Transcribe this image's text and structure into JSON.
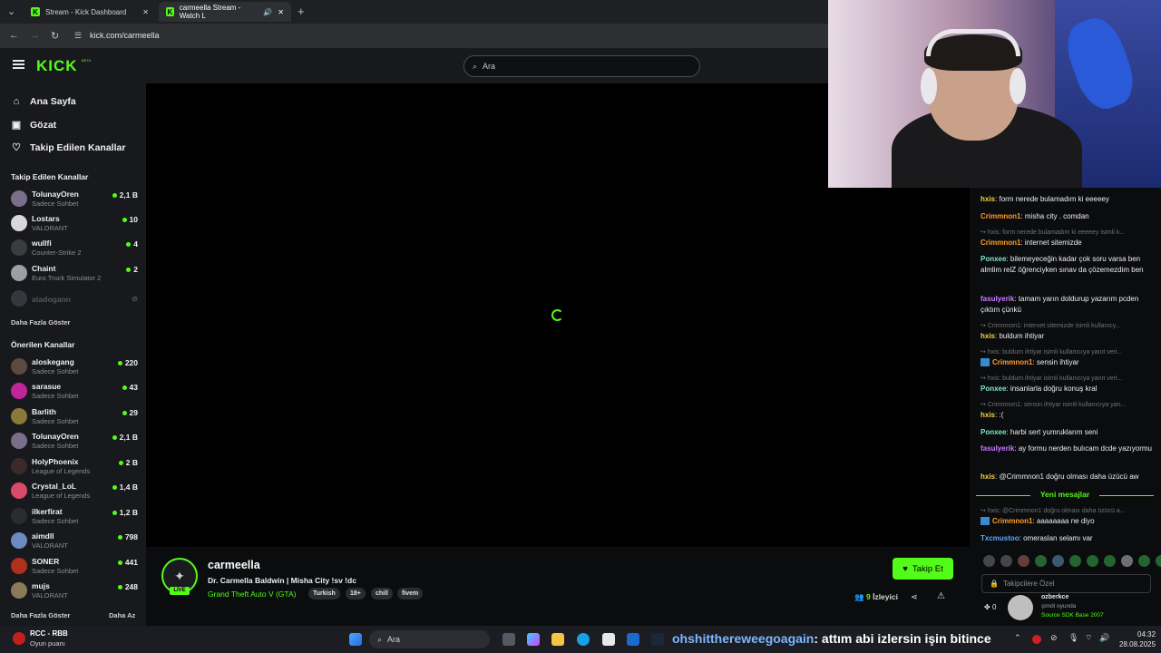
{
  "browser": {
    "tabs": [
      {
        "title": "Stream - Kick Dashboard",
        "active": false
      },
      {
        "title": "carmeella Stream - Watch L",
        "active": true
      }
    ],
    "url": "kick.com/carmeella"
  },
  "header": {
    "logo": "KICK",
    "beta": "BETA",
    "search_placeholder": "Ara"
  },
  "sidebar": {
    "nav": [
      {
        "label": "Ana Sayfa",
        "icon": "home-icon"
      },
      {
        "label": "Gözat",
        "icon": "browse-icon"
      },
      {
        "label": "Takip Edilen Kanallar",
        "icon": "heart-icon"
      }
    ],
    "followed_title": "Takip Edilen Kanallar",
    "followed": [
      {
        "name": "TolunayOren",
        "game": "Sadece Sohbet",
        "viewers": "2,1 B"
      },
      {
        "name": "Lostars",
        "game": "VALORANT",
        "viewers": "10"
      },
      {
        "name": "wullfi",
        "game": "Counter-Strike 2",
        "viewers": "4"
      },
      {
        "name": "Chaint",
        "game": "Euro Truck Simulator 2",
        "viewers": "2"
      },
      {
        "name": "atadogann",
        "game": "",
        "viewers": ""
      }
    ],
    "show_more_1": "Daha Fazla Göster",
    "recommended_title": "Önerilen Kanallar",
    "recommended": [
      {
        "name": "aloskegang",
        "game": "Sadece Sohbet",
        "viewers": "220"
      },
      {
        "name": "sarasue",
        "game": "Sadece Sohbet",
        "viewers": "43"
      },
      {
        "name": "Barlith",
        "game": "Sadece Sohbet",
        "viewers": "29"
      },
      {
        "name": "TolunayOren",
        "game": "Sadece Sohbet",
        "viewers": "2,1 B"
      },
      {
        "name": "HolyPhoenix",
        "game": "League of Legends",
        "viewers": "2 B"
      },
      {
        "name": "Crystal_LoL",
        "game": "League of Legends",
        "viewers": "1,4 B"
      },
      {
        "name": "ilkerfirat",
        "game": "Sadece Sohbet",
        "viewers": "1,2 B"
      },
      {
        "name": "aimdll",
        "game": "VALORANT",
        "viewers": "798"
      },
      {
        "name": "SONER",
        "game": "Sadece Sohbet",
        "viewers": "441"
      },
      {
        "name": "mujs",
        "game": "VALORANT",
        "viewers": "248"
      }
    ],
    "show_more_2": "Daha Fazla Göster",
    "show_less": "Daha Az"
  },
  "stream": {
    "live": "LIVE",
    "streamer": "carmeella",
    "title": "Dr. Carmella Baldwin |  Misha City   !sv !dc",
    "category": "Grand Theft Auto V (GTA)",
    "tags": [
      "Turkish",
      "18+",
      "chill",
      "fivem"
    ],
    "follow_label": "Takip Et",
    "viewer_count": "9",
    "viewer_label": "İzleyici"
  },
  "chat": {
    "messages": [
      {
        "reply": "",
        "user": "hxis",
        "color": "#f5d442",
        "text": "form nerede bulamadım ki eeeeey"
      },
      {
        "reply": "",
        "user": "Crimmnon1",
        "color": "#ff9e2c",
        "text": "misha city . comdan"
      },
      {
        "reply": "hxis: form nerede bulamadım ki eeeeey isimli k...",
        "user": "Crimmnon1",
        "color": "#ff9e2c",
        "text": "internet sitemizde"
      },
      {
        "reply": "",
        "user": "Ponxee",
        "color": "#7ee8c8",
        "text": "bilemeyeceğin kadar çok soru varsa ben almlim relZ öğrenciyken sınav da çözemezdim ben"
      },
      {
        "reply": "",
        "user": "fasulyerik",
        "color": "#c77dff",
        "text": "tamam yarın doldurup yazarım pcden çıktım çünkü"
      },
      {
        "reply": "Crimmnon1: internet sitemizde isimli kullanıcy...",
        "user": "hxis",
        "color": "#f5d442",
        "text": "buldum ihtiyar"
      },
      {
        "reply": "hxis: buldum ihtiyar isimli kullanıcıya yanıt veri...",
        "user": "Crimmnon1",
        "color": "#ff9e2c",
        "text": "sensin ihtiyar"
      },
      {
        "reply": "hxis: buldum ihtiyar isimli kullanıcıya yanıt veri...",
        "user": "Ponxee",
        "color": "#7ee8c8",
        "text": "insanlarla doğru konuş kral"
      },
      {
        "reply": "Crimmnon1: sensin ihtiyar isimli kullanıcıya yan...",
        "user": "hxis",
        "color": "#f5d442",
        "text": ":("
      },
      {
        "reply": "",
        "user": "Ponxee",
        "color": "#7ee8c8",
        "text": "harbi sert yumruklarım seni"
      },
      {
        "reply": "",
        "user": "fasulyerik",
        "color": "#c77dff",
        "text": "ay formu nerden bulıcam dcde yazıyormu"
      },
      {
        "reply": "",
        "user": "hxis",
        "color": "#f5d442",
        "text": "@Crimmnon1 doğru olması daha üzücü aw"
      }
    ],
    "new_messages": "Yeni mesajlar",
    "after_new": [
      {
        "reply": "hxis: @Crimmnon1 doğru olması daha üzücü a...",
        "user": "Crimmnon1",
        "color": "#ff9e2c",
        "text": "aaaaaaaa ne diyo"
      },
      {
        "reply": "",
        "user": "Txcmustoo",
        "color": "#5aa9ff",
        "text": "omeraslan selamı var"
      }
    ],
    "input_placeholder": "Takipcilere Özel",
    "points": "0"
  },
  "now_playing": {
    "name": "ozberkce",
    "status": "şimdi oyunda",
    "game": "Source SDK Base 2007"
  },
  "taskbar": {
    "widget_title": "RCC - RBB",
    "widget_sub": "Oyun puanı",
    "search_placeholder": "Ara",
    "ticker_user": "ohshitthereweegoagain",
    "ticker_text": ": attım abi izlersin işin bitince",
    "time": "04:32",
    "date": "28.08.2025"
  }
}
